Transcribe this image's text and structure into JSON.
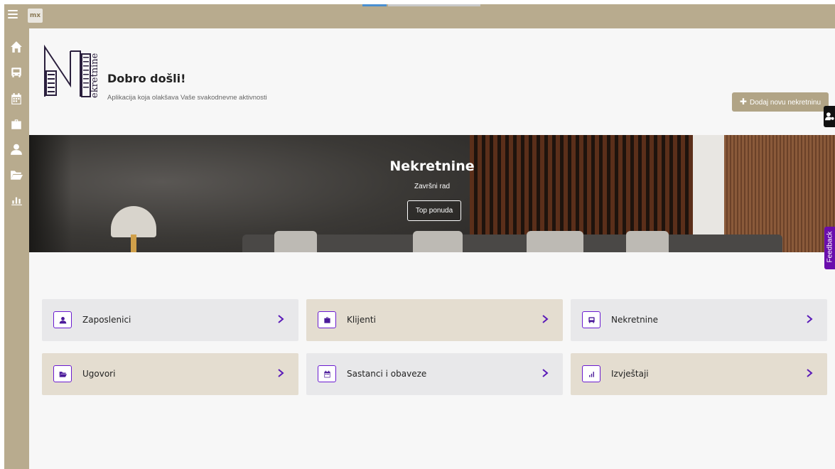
{
  "topbar": {
    "logo_text": "mx"
  },
  "sidebar": {
    "items": [
      {
        "icon": "home-icon"
      },
      {
        "icon": "bus-icon"
      },
      {
        "icon": "calendar-icon"
      },
      {
        "icon": "briefcase-icon"
      },
      {
        "icon": "user-icon"
      },
      {
        "icon": "folder-icon"
      },
      {
        "icon": "bar-chart-icon"
      }
    ]
  },
  "header": {
    "logo_text": "ekretnine",
    "welcome": "Dobro došli!",
    "tagline": "Aplikacija koja olakšava Vaše svakodnevne aktivnosti",
    "add_button": "Dodaj novu nekretninu"
  },
  "hero": {
    "title": "Nekretnine",
    "subtitle": "Završni rad",
    "button": "Top ponuda"
  },
  "feedback_label": "Feedback",
  "tiles": [
    {
      "label": "Zaposlenici",
      "icon": "user-icon"
    },
    {
      "label": "Klijenti",
      "icon": "briefcase-icon"
    },
    {
      "label": "Nekretnine",
      "icon": "bus-icon"
    },
    {
      "label": "Ugovori",
      "icon": "folder-icon"
    },
    {
      "label": "Sastanci i obaveze",
      "icon": "calendar-icon"
    },
    {
      "label": "Izvještaji",
      "icon": "bar-chart-icon"
    }
  ],
  "colors": {
    "sidebar": "#b8ab8e",
    "accent": "#6a1ad0",
    "button": "#b1a486",
    "tile_gray": "#e8e8ea",
    "tile_beige": "#e4ddd0"
  }
}
